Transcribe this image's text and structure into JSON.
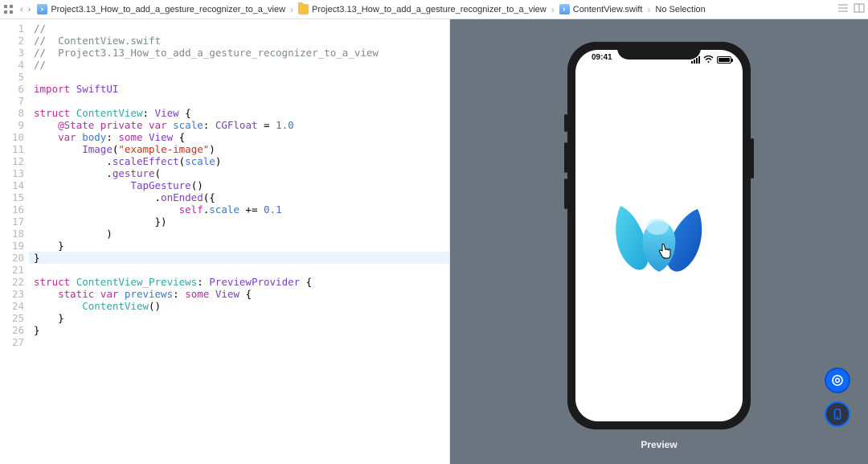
{
  "breadcrumb": {
    "nav_back": "‹",
    "nav_fwd": "›",
    "items": [
      {
        "icon": "swift-file-icon",
        "label": "Project3.13_How_to_add_a_gesture_recognizer_to_a_view"
      },
      {
        "icon": "folder-icon",
        "label": "Project3.13_How_to_add_a_gesture_recognizer_to_a_view"
      },
      {
        "icon": "swift-file-icon",
        "label": "ContentView.swift"
      },
      {
        "icon": "",
        "label": "No Selection"
      }
    ]
  },
  "editor": {
    "highlighted_line": 20,
    "lines": [
      "//",
      "//  ContentView.swift",
      "//  Project3.13_How_to_add_a_gesture_recognizer_to_a_view",
      "//",
      "",
      "import SwiftUI",
      "",
      "struct ContentView: View {",
      "    @State private var scale: CGFloat = 1.0",
      "    var body: some View {",
      "        Image(\"example-image\")",
      "            .scaleEffect(scale)",
      "            .gesture(",
      "                TapGesture()",
      "                    .onEnded({",
      "                        self.scale += 0.1",
      "                    })",
      "            )",
      "    }",
      "}",
      "",
      "struct ContentView_Previews: PreviewProvider {",
      "    static var previews: some View {",
      "        ContentView()",
      "    }",
      "}",
      ""
    ]
  },
  "preview": {
    "status_time": "09:41",
    "label": "Preview",
    "image_name": "example-image"
  }
}
